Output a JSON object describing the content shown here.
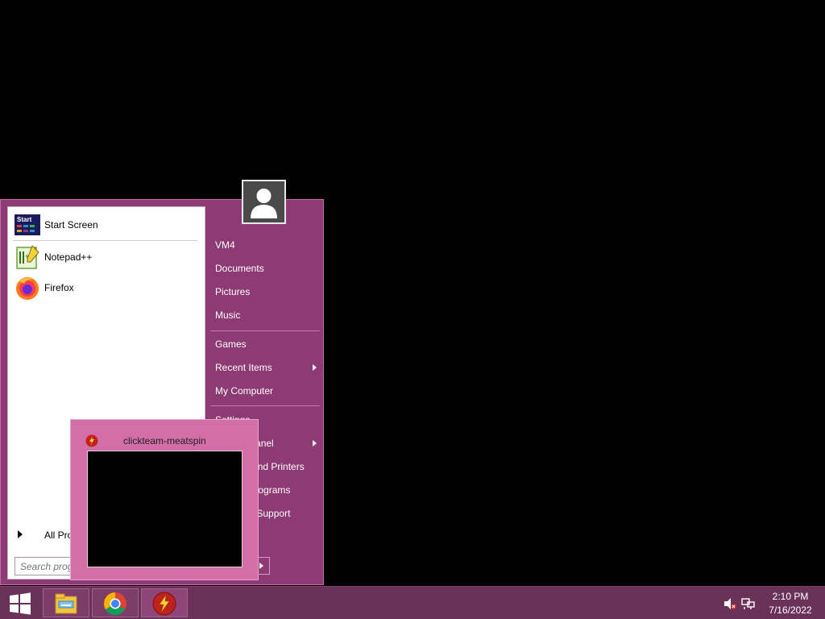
{
  "start_menu": {
    "pinned_items": [
      {
        "label": "Start Screen",
        "icon": "start-screen-icon"
      },
      {
        "label": "Notepad++",
        "icon": "notepad-plus-plus-icon"
      },
      {
        "label": "Firefox",
        "icon": "firefox-icon"
      }
    ],
    "all_programs_label": "All Programs",
    "search": {
      "placeholder": "Search programs and files"
    },
    "right_items": [
      {
        "label": "VM4"
      },
      {
        "label": "Documents"
      },
      {
        "label": "Pictures"
      },
      {
        "label": "Music"
      },
      {
        "label": "Games"
      },
      {
        "label": "Recent Items",
        "has_submenu": true
      },
      {
        "label": "My Computer"
      },
      {
        "label": "Settings"
      },
      {
        "label": "Control Panel",
        "has_submenu": true
      },
      {
        "label": "Devices and Printers"
      },
      {
        "label": "Default Programs"
      },
      {
        "label": "Help and Support"
      }
    ]
  },
  "thumbnail": {
    "title": "clickteam-meatspin",
    "icon": "clickteam-app-icon"
  },
  "taskbar": {
    "start_icon": "windows-logo-icon",
    "buttons": [
      {
        "name": "file-explorer",
        "icon": "file-explorer-icon"
      },
      {
        "name": "chrome",
        "icon": "chrome-icon"
      },
      {
        "name": "clickteam-app",
        "icon": "clickteam-app-icon"
      }
    ],
    "tray": {
      "volume_icon": "volume-muted-icon",
      "network_icon": "network-icon",
      "time": "2:10 PM",
      "date": "7/16/2022"
    }
  },
  "colors": {
    "accent": "#8e3a74",
    "taskbar": "#6b3259",
    "thumbnail": "#d36ea8"
  }
}
